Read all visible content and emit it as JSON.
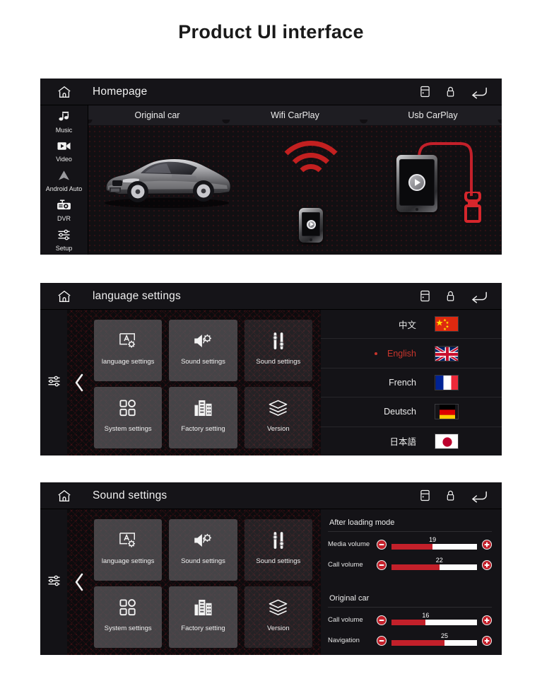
{
  "page": {
    "title": "Product UI interface"
  },
  "colors": {
    "accent": "#c3202a",
    "selected": "#c9352c",
    "panel_bg": "#0c0b0d",
    "titlebar_bg": "#151418"
  },
  "panel_home": {
    "titlebar": {
      "home_icon": "home-icon",
      "title": "Homepage",
      "icons": [
        "car-door-icon",
        "lock-icon",
        "back-arrow-icon"
      ]
    },
    "sidebar": [
      {
        "label": "Music",
        "icon": "music-note-icon"
      },
      {
        "label": "Video",
        "icon": "video-camera-icon"
      },
      {
        "label": "Android Auto",
        "icon": "android-auto-icon"
      },
      {
        "label": "DVR",
        "icon": "dashcam-icon"
      },
      {
        "label": "Setup",
        "icon": "sliders-icon"
      }
    ],
    "tabs": [
      {
        "label": "Original car"
      },
      {
        "label": "Wifi CarPlay"
      },
      {
        "label": "Usb CarPlay"
      }
    ],
    "graphics": {
      "car": "car-coupe-image",
      "wifi": "wifi-waves-phone-image",
      "usb": "phone-usb-cable-image"
    }
  },
  "panel_language": {
    "titlebar": {
      "home_icon": "home-icon",
      "title": "language settings",
      "icons": [
        "car-door-icon",
        "lock-icon",
        "back-arrow-icon"
      ]
    },
    "rail_icon": "sliders-icon",
    "back_chevron": "‹",
    "tiles": [
      {
        "label": "language settings",
        "icon": "language-screen-gear-icon",
        "dim": false
      },
      {
        "label": "Sound settings",
        "icon": "speaker-gear-icon",
        "dim": false
      },
      {
        "label": "Sound settings",
        "icon": "equalizer-icon",
        "dim": true
      },
      {
        "label": "System settings",
        "icon": "grid-shapes-icon",
        "dim": false
      },
      {
        "label": "Factory setting",
        "icon": "factory-building-icon",
        "dim": false
      },
      {
        "label": "Version",
        "icon": "layers-icon",
        "dim": true
      }
    ],
    "languages": [
      {
        "name": "中文",
        "flag": "flag-china",
        "selected": false
      },
      {
        "name": "English",
        "flag": "flag-uk",
        "selected": true
      },
      {
        "name": "French",
        "flag": "flag-france",
        "selected": false
      },
      {
        "name": "Deutsch",
        "flag": "flag-germany",
        "selected": false
      },
      {
        "name": "日本語",
        "flag": "flag-japan",
        "selected": false
      }
    ]
  },
  "panel_sound": {
    "titlebar": {
      "home_icon": "home-icon",
      "title": "Sound settings",
      "icons": [
        "car-door-icon",
        "lock-icon",
        "back-arrow-icon"
      ]
    },
    "rail_icon": "sliders-icon",
    "back_chevron": "‹",
    "tiles": [
      {
        "label": "language settings",
        "icon": "language-screen-gear-icon",
        "dim": false
      },
      {
        "label": "Sound settings",
        "icon": "speaker-gear-icon",
        "dim": false
      },
      {
        "label": "Sound settings",
        "icon": "equalizer-icon",
        "dim": true
      },
      {
        "label": "System settings",
        "icon": "grid-shapes-icon",
        "dim": false
      },
      {
        "label": "Factory setting",
        "icon": "factory-building-icon",
        "dim": false
      },
      {
        "label": "Version",
        "icon": "layers-icon",
        "dim": true
      }
    ],
    "volume_groups": [
      {
        "heading": "After loading mode",
        "rows": [
          {
            "label": "Media volume",
            "value": "19",
            "percent": 48
          },
          {
            "label": "Call volume",
            "value": "22",
            "percent": 56
          }
        ]
      },
      {
        "heading": "Original car",
        "rows": [
          {
            "label": "Call volume",
            "value": "16",
            "percent": 40
          },
          {
            "label": "Navigation",
            "value": "25",
            "percent": 62
          }
        ]
      }
    ]
  }
}
